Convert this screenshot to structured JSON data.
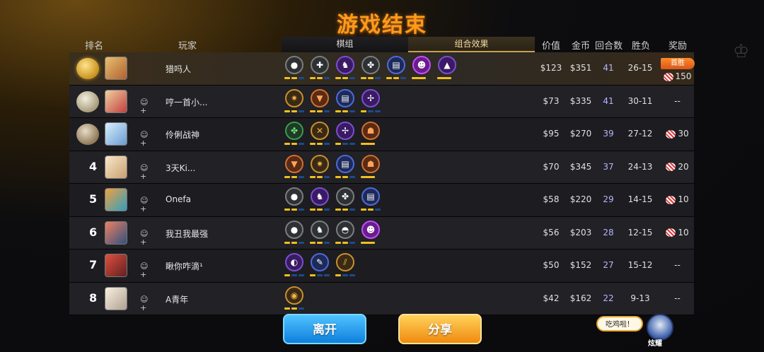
{
  "title": "游戏结束",
  "headers": {
    "rank": "排名",
    "player": "玩家",
    "board_tab": "棋组",
    "combo_tab": "组合效果",
    "value": "价值",
    "gold": "金币",
    "rounds": "回合数",
    "win_loss": "胜负",
    "reward": "奖励"
  },
  "rows": [
    {
      "rank": "1",
      "name": "猎吗人",
      "value": "$123",
      "gold": "$351",
      "rounds": "41",
      "wl": "26-15",
      "reward": "150",
      "first_win": "首胜"
    },
    {
      "rank": "2",
      "name": "哼一首小...",
      "value": "$73",
      "gold": "$335",
      "rounds": "41",
      "wl": "30-11",
      "reward": "--"
    },
    {
      "rank": "3",
      "name": "伶俐战神",
      "value": "$95",
      "gold": "$270",
      "rounds": "39",
      "wl": "27-12",
      "reward": "30"
    },
    {
      "rank": "4",
      "name": "3天Ki...",
      "value": "$70",
      "gold": "$345",
      "rounds": "37",
      "wl": "24-13",
      "reward": "20"
    },
    {
      "rank": "5",
      "name": "Onefa",
      "value": "$58",
      "gold": "$220",
      "rounds": "29",
      "wl": "14-15",
      "reward": "10"
    },
    {
      "rank": "6",
      "name": "我丑我最强",
      "value": "$56",
      "gold": "$203",
      "rounds": "28",
      "wl": "12-15",
      "reward": "10"
    },
    {
      "rank": "7",
      "name": "瞅你咋滴¹",
      "value": "$50",
      "gold": "$152",
      "rounds": "27",
      "wl": "15-12",
      "reward": "--"
    },
    {
      "rank": "8",
      "name": "A青年",
      "value": "$42",
      "gold": "$162",
      "rounds": "22",
      "wl": "9-13",
      "reward": "--"
    }
  ],
  "buttons": {
    "leave": "离开",
    "share": "分享"
  },
  "speech": "吃鸡啦！",
  "mascot_label": "炫耀",
  "colors": {
    "title": "#ff9a1c",
    "leave": "#1e8ee8",
    "share": "#f5a020",
    "round_text": "#b5b6ff"
  }
}
